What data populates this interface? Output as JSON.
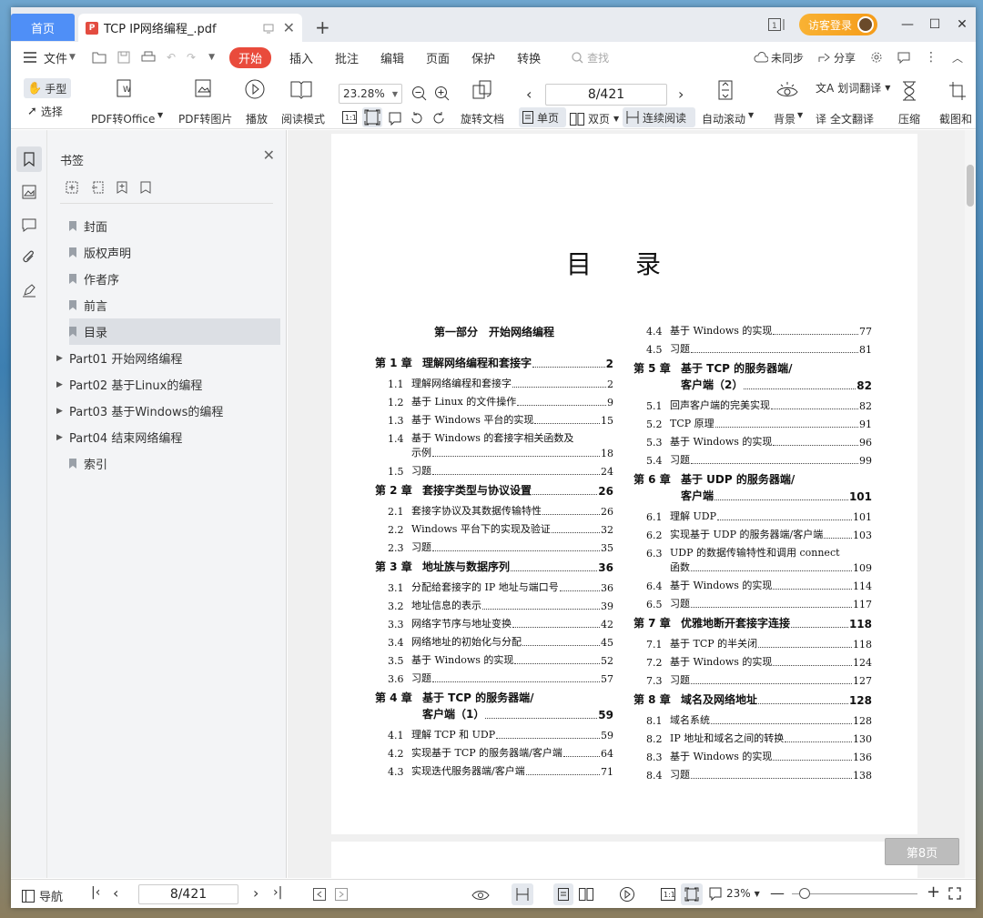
{
  "titlebar": {
    "home_tab": "首页",
    "doc_tab_title": "TCP IP网络编程_.pdf",
    "login_label": "访客登录"
  },
  "menubar": {
    "file": "文件",
    "items": [
      "开始",
      "插入",
      "批注",
      "编辑",
      "页面",
      "保护",
      "转换"
    ],
    "search_placeholder": "查找",
    "sync": "未同步",
    "share": "分享"
  },
  "toolbar": {
    "hand": "手型",
    "select": "选择",
    "pdf_to_office": "PDF转Office",
    "pdf_to_image": "PDF转图片",
    "play": "播放",
    "read_mode": "阅读模式",
    "zoom": "23.28%",
    "rotate": "旋转文档",
    "page_current": "8/421",
    "single": "单页",
    "double": "双页",
    "continuous": "连续阅读",
    "auto_scroll": "自动滚动",
    "background": "背景",
    "word_translate": "划词翻译",
    "full_translate": "全文翻译",
    "compress": "压缩",
    "screenshot": "截图和"
  },
  "panel": {
    "title": "书签",
    "items": [
      {
        "label": "封面",
        "expandable": false
      },
      {
        "label": "版权声明",
        "expandable": false
      },
      {
        "label": "作者序",
        "expandable": false
      },
      {
        "label": "前言",
        "expandable": false
      },
      {
        "label": "目录",
        "expandable": false,
        "active": true
      },
      {
        "label": "Part01 开始网络编程",
        "expandable": true
      },
      {
        "label": "Part02 基于Linux的编程",
        "expandable": true
      },
      {
        "label": "Part03 基于Windows的编程",
        "expandable": true
      },
      {
        "label": "Part04 结束网络编程",
        "expandable": true
      },
      {
        "label": "索引",
        "expandable": false
      }
    ]
  },
  "document": {
    "toc_title": "目录",
    "page_badge": "第8页",
    "left_column": [
      {
        "kind": "part",
        "text": "第一部分　开始网络编程"
      },
      {
        "kind": "chap",
        "num": "第 1 章",
        "text": "理解网络编程和套接字",
        "pg": "2"
      },
      {
        "kind": "sec",
        "num": "1.1",
        "text": "理解网络编程和套接字",
        "pg": "2"
      },
      {
        "kind": "sec",
        "num": "1.2",
        "text": "基于 Linux 的文件操作",
        "pg": "9"
      },
      {
        "kind": "sec",
        "num": "1.3",
        "text": "基于 Windows 平台的实现",
        "pg": "15"
      },
      {
        "kind": "sec2",
        "num": "1.4",
        "text": "基于 Windows 的套接字相关函数及",
        "cont": "示例",
        "pg": "18"
      },
      {
        "kind": "sec",
        "num": "1.5",
        "text": "习题",
        "pg": "24"
      },
      {
        "kind": "chap",
        "num": "第 2 章",
        "text": "套接字类型与协议设置",
        "pg": "26"
      },
      {
        "kind": "sec",
        "num": "2.1",
        "text": "套接字协议及其数据传输特性",
        "pg": "26"
      },
      {
        "kind": "sec",
        "num": "2.2",
        "text": "Windows 平台下的实现及验证",
        "pg": "32"
      },
      {
        "kind": "sec",
        "num": "2.3",
        "text": "习题",
        "pg": "35"
      },
      {
        "kind": "chap",
        "num": "第 3 章",
        "text": "地址族与数据序列",
        "pg": "36"
      },
      {
        "kind": "sec",
        "num": "3.1",
        "text": "分配给套接字的 IP 地址与端口号",
        "pg": "36"
      },
      {
        "kind": "sec",
        "num": "3.2",
        "text": "地址信息的表示",
        "pg": "39"
      },
      {
        "kind": "sec",
        "num": "3.3",
        "text": "网络字节序与地址变换",
        "pg": "42"
      },
      {
        "kind": "sec",
        "num": "3.4",
        "text": "网络地址的初始化与分配",
        "pg": "45"
      },
      {
        "kind": "sec",
        "num": "3.5",
        "text": "基于 Windows 的实现",
        "pg": "52"
      },
      {
        "kind": "sec",
        "num": "3.6",
        "text": "习题",
        "pg": "57"
      },
      {
        "kind": "chap2",
        "num": "第 4 章",
        "text": "基于 TCP 的服务器端/",
        "cont": "客户端（1）",
        "pg": "59"
      },
      {
        "kind": "sec",
        "num": "4.1",
        "text": "理解 TCP 和 UDP",
        "pg": "59"
      },
      {
        "kind": "sec",
        "num": "4.2",
        "text": "实现基于 TCP 的服务器端/客户端",
        "pg": "64"
      },
      {
        "kind": "sec",
        "num": "4.3",
        "text": "实现迭代服务器端/客户端",
        "pg": "71"
      }
    ],
    "right_column": [
      {
        "kind": "sec",
        "num": "4.4",
        "text": "基于 Windows 的实现",
        "pg": "77"
      },
      {
        "kind": "sec",
        "num": "4.5",
        "text": "习题",
        "pg": "81"
      },
      {
        "kind": "chap2",
        "num": "第 5 章",
        "text": "基于 TCP 的服务器端/",
        "cont": "客户端（2）",
        "pg": "82"
      },
      {
        "kind": "sec",
        "num": "5.1",
        "text": "回声客户端的完美实现",
        "pg": "82"
      },
      {
        "kind": "sec",
        "num": "5.2",
        "text": "TCP 原理",
        "pg": "91"
      },
      {
        "kind": "sec",
        "num": "5.3",
        "text": "基于 Windows 的实现",
        "pg": "96"
      },
      {
        "kind": "sec",
        "num": "5.4",
        "text": "习题",
        "pg": "99"
      },
      {
        "kind": "chap2",
        "num": "第 6 章",
        "text": "基于 UDP 的服务器端/",
        "cont": "客户端",
        "pg": "101"
      },
      {
        "kind": "sec",
        "num": "6.1",
        "text": "理解 UDP",
        "pg": "101"
      },
      {
        "kind": "sec",
        "num": "6.2",
        "text": "实现基于 UDP 的服务器端/客户端",
        "pg": "103"
      },
      {
        "kind": "sec2",
        "num": "6.3",
        "text": "UDP 的数据传输特性和调用 connect",
        "cont": "函数",
        "pg": "109"
      },
      {
        "kind": "sec",
        "num": "6.4",
        "text": "基于 Windows 的实现",
        "pg": "114"
      },
      {
        "kind": "sec",
        "num": "6.5",
        "text": "习题",
        "pg": "117"
      },
      {
        "kind": "chap",
        "num": "第 7 章",
        "text": "优雅地断开套接字连接",
        "pg": "118"
      },
      {
        "kind": "sec",
        "num": "7.1",
        "text": "基于 TCP 的半关闭",
        "pg": "118"
      },
      {
        "kind": "sec",
        "num": "7.2",
        "text": "基于 Windows 的实现",
        "pg": "124"
      },
      {
        "kind": "sec",
        "num": "7.3",
        "text": "习题",
        "pg": "127"
      },
      {
        "kind": "chap",
        "num": "第 8 章",
        "text": "域名及网络地址",
        "pg": "128"
      },
      {
        "kind": "sec",
        "num": "8.1",
        "text": "域名系统",
        "pg": "128"
      },
      {
        "kind": "sec",
        "num": "8.2",
        "text": "IP 地址和域名之间的转换",
        "pg": "130"
      },
      {
        "kind": "sec",
        "num": "8.3",
        "text": "基于 Windows 的实现",
        "pg": "136"
      },
      {
        "kind": "sec",
        "num": "8.4",
        "text": "习题",
        "pg": "138"
      }
    ]
  },
  "statusbar": {
    "nav": "导航",
    "page_current": "8/421",
    "zoom": "23%"
  }
}
